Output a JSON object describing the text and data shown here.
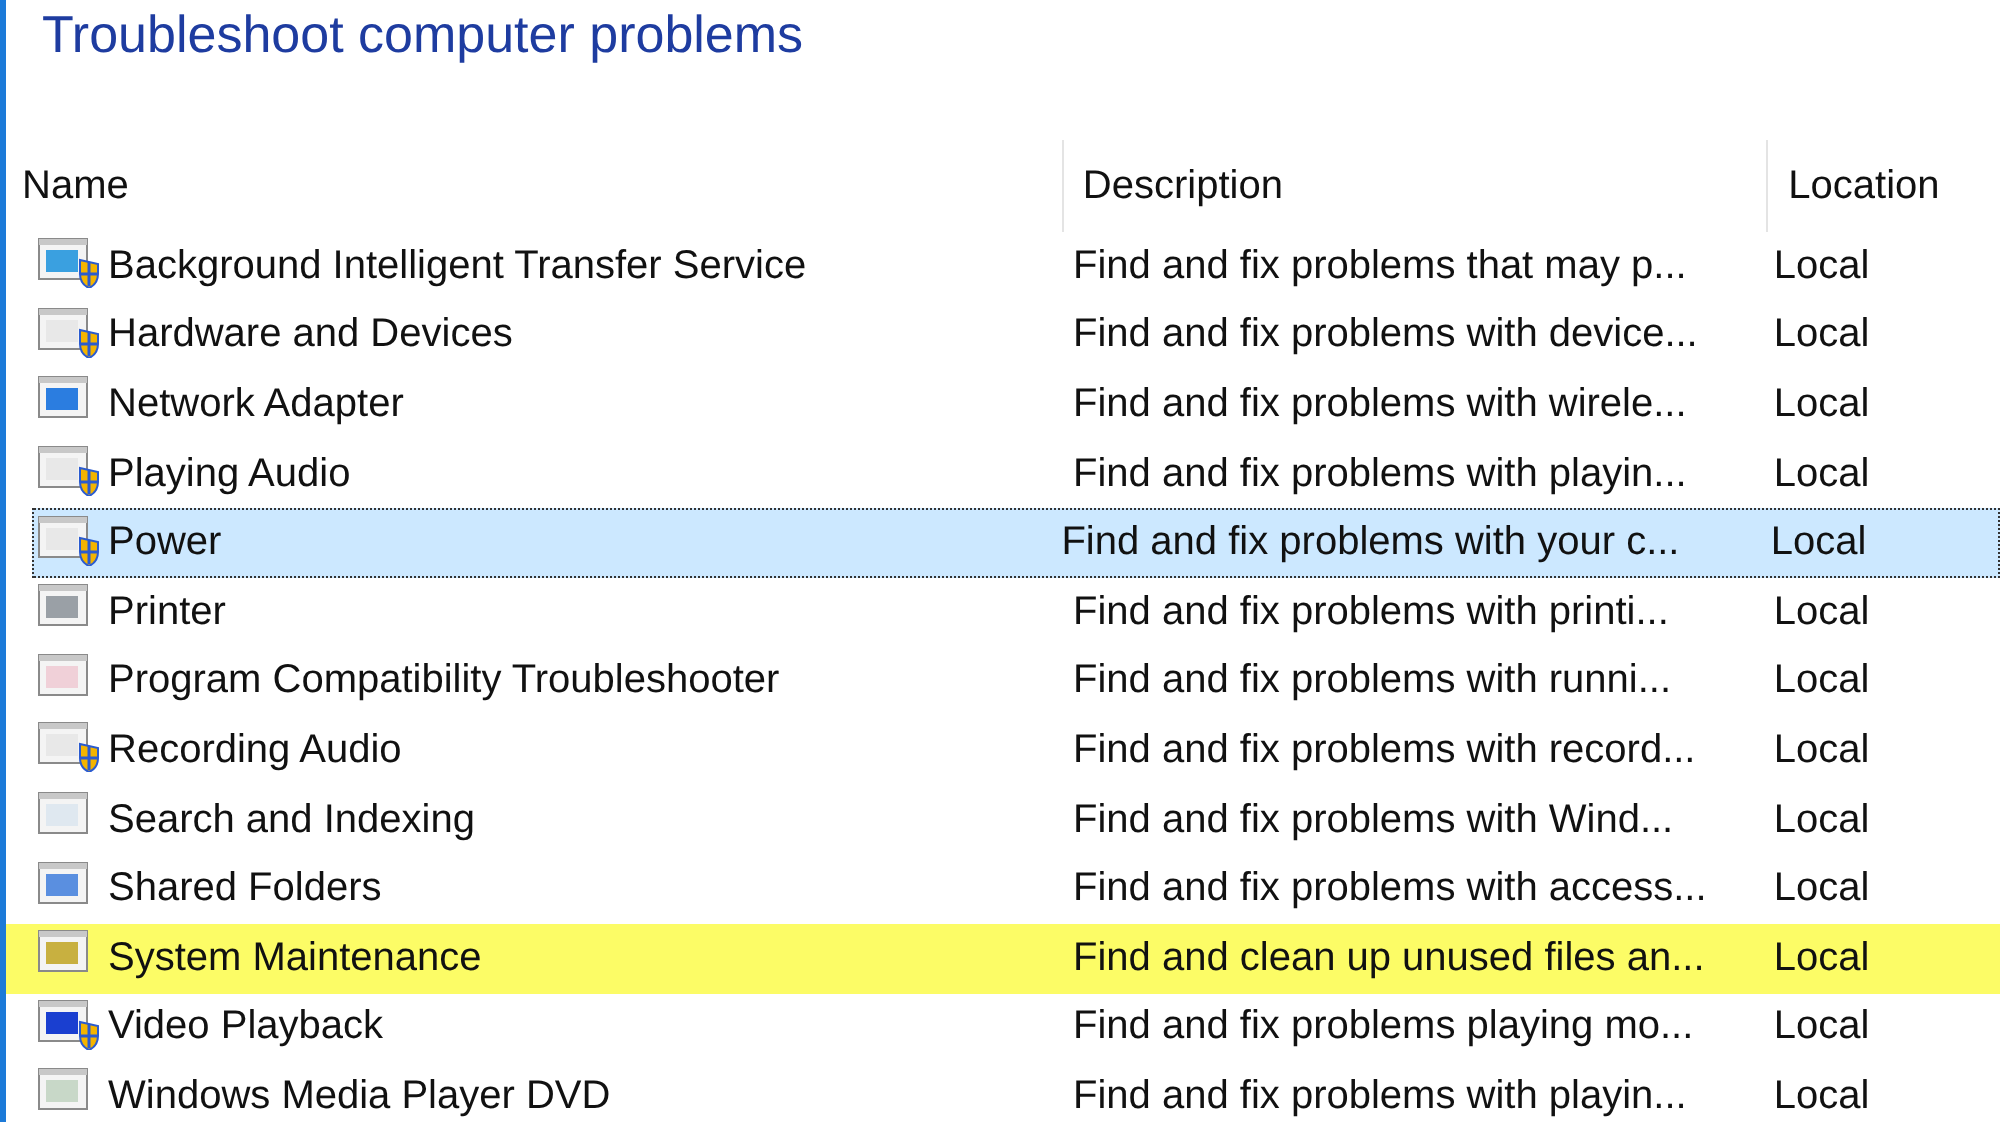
{
  "title": "Troubleshoot computer problems",
  "table": {
    "columns": [
      "Name",
      "Description",
      "Location"
    ],
    "rows": [
      {
        "name": "Background Intelligent Transfer Service",
        "description": "Find and fix problems that may p...",
        "location": "Local",
        "selected": false,
        "highlighted": false
      },
      {
        "name": "Hardware and Devices",
        "description": "Find and fix problems with device...",
        "location": "Local",
        "selected": false,
        "highlighted": false
      },
      {
        "name": "Network Adapter",
        "description": "Find and fix problems with wirele...",
        "location": "Local",
        "selected": false,
        "highlighted": false
      },
      {
        "name": "Playing Audio",
        "description": "Find and fix problems with playin...",
        "location": "Local",
        "selected": false,
        "highlighted": false
      },
      {
        "name": "Power",
        "description": "Find and fix problems with your c...",
        "location": "Local",
        "selected": true,
        "highlighted": false
      },
      {
        "name": "Printer",
        "description": "Find and fix problems with printi...",
        "location": "Local",
        "selected": false,
        "highlighted": false
      },
      {
        "name": "Program Compatibility Troubleshooter",
        "description": "Find and fix problems with runni...",
        "location": "Local",
        "selected": false,
        "highlighted": false
      },
      {
        "name": "Recording Audio",
        "description": "Find and fix problems with record...",
        "location": "Local",
        "selected": false,
        "highlighted": false
      },
      {
        "name": "Search and Indexing",
        "description": "Find and fix problems with Wind...",
        "location": "Local",
        "selected": false,
        "highlighted": false
      },
      {
        "name": "Shared Folders",
        "description": "Find and fix problems with access...",
        "location": "Local",
        "selected": false,
        "highlighted": false
      },
      {
        "name": "System Maintenance",
        "description": "Find and clean up unused files an...",
        "location": "Local",
        "selected": false,
        "highlighted": true
      },
      {
        "name": "Video Playback",
        "description": "Find and fix problems playing mo...",
        "location": "Local",
        "selected": false,
        "highlighted": false
      },
      {
        "name": "Windows Media Player DVD",
        "description": "Find and fix problems with playin...",
        "location": "Local",
        "selected": false,
        "highlighted": false
      }
    ]
  }
}
